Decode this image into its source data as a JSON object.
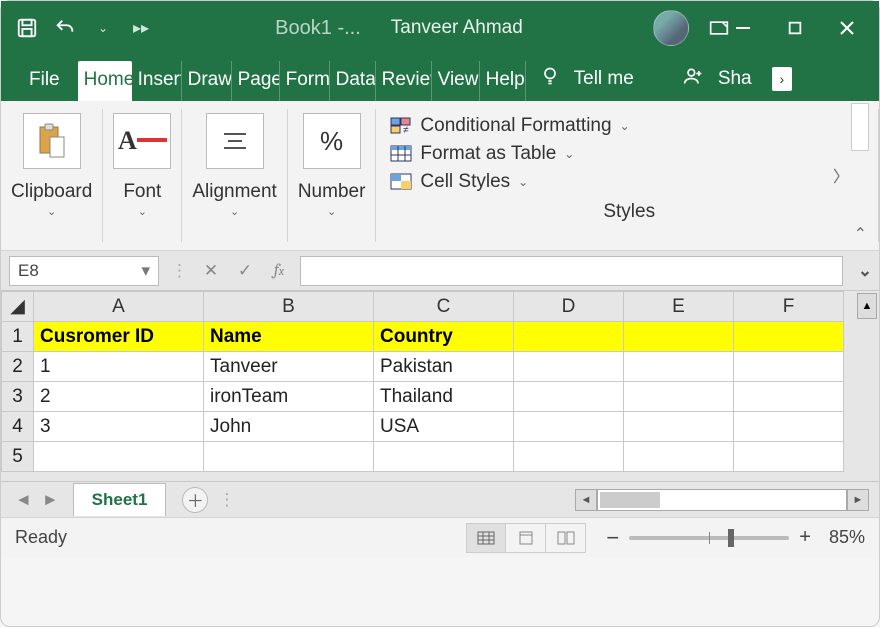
{
  "title": {
    "book": "Book1  -...",
    "user": "Tanveer Ahmad"
  },
  "tabs": {
    "items": [
      "File",
      "Home",
      "Insert",
      "Draw",
      "Page",
      "Format",
      "Data",
      "Review",
      "View",
      "Help"
    ],
    "active_index": 1,
    "tellme": "Tell me",
    "share": "Share"
  },
  "ribbon": {
    "clipboard": "Clipboard",
    "font": "Font",
    "alignment": "Alignment",
    "number": "Number",
    "styles_label": "Styles",
    "cond_format": "Conditional Formatting",
    "format_table": "Format as Table",
    "cell_styles": "Cell Styles"
  },
  "formula": {
    "namebox": "E8",
    "value": ""
  },
  "grid": {
    "columns": [
      "A",
      "B",
      "C",
      "D",
      "E",
      "F"
    ],
    "rows": [
      {
        "n": "1",
        "cells": [
          "Cusromer ID",
          "Name",
          "Country",
          "",
          "",
          ""
        ],
        "header": true
      },
      {
        "n": "2",
        "cells": [
          "1",
          "Tanveer",
          "Pakistan",
          "",
          "",
          ""
        ],
        "numcol0": true
      },
      {
        "n": "3",
        "cells": [
          "2",
          "ironTeam",
          "Thailand",
          "",
          "",
          ""
        ],
        "numcol0": true
      },
      {
        "n": "4",
        "cells": [
          "3",
          "John",
          "USA",
          "",
          "",
          ""
        ],
        "numcol0": true
      },
      {
        "n": "5",
        "cells": [
          "",
          "",
          "",
          "",
          "",
          ""
        ]
      }
    ]
  },
  "sheets": {
    "active": "Sheet1"
  },
  "status": {
    "ready": "Ready",
    "zoom": "85%"
  }
}
